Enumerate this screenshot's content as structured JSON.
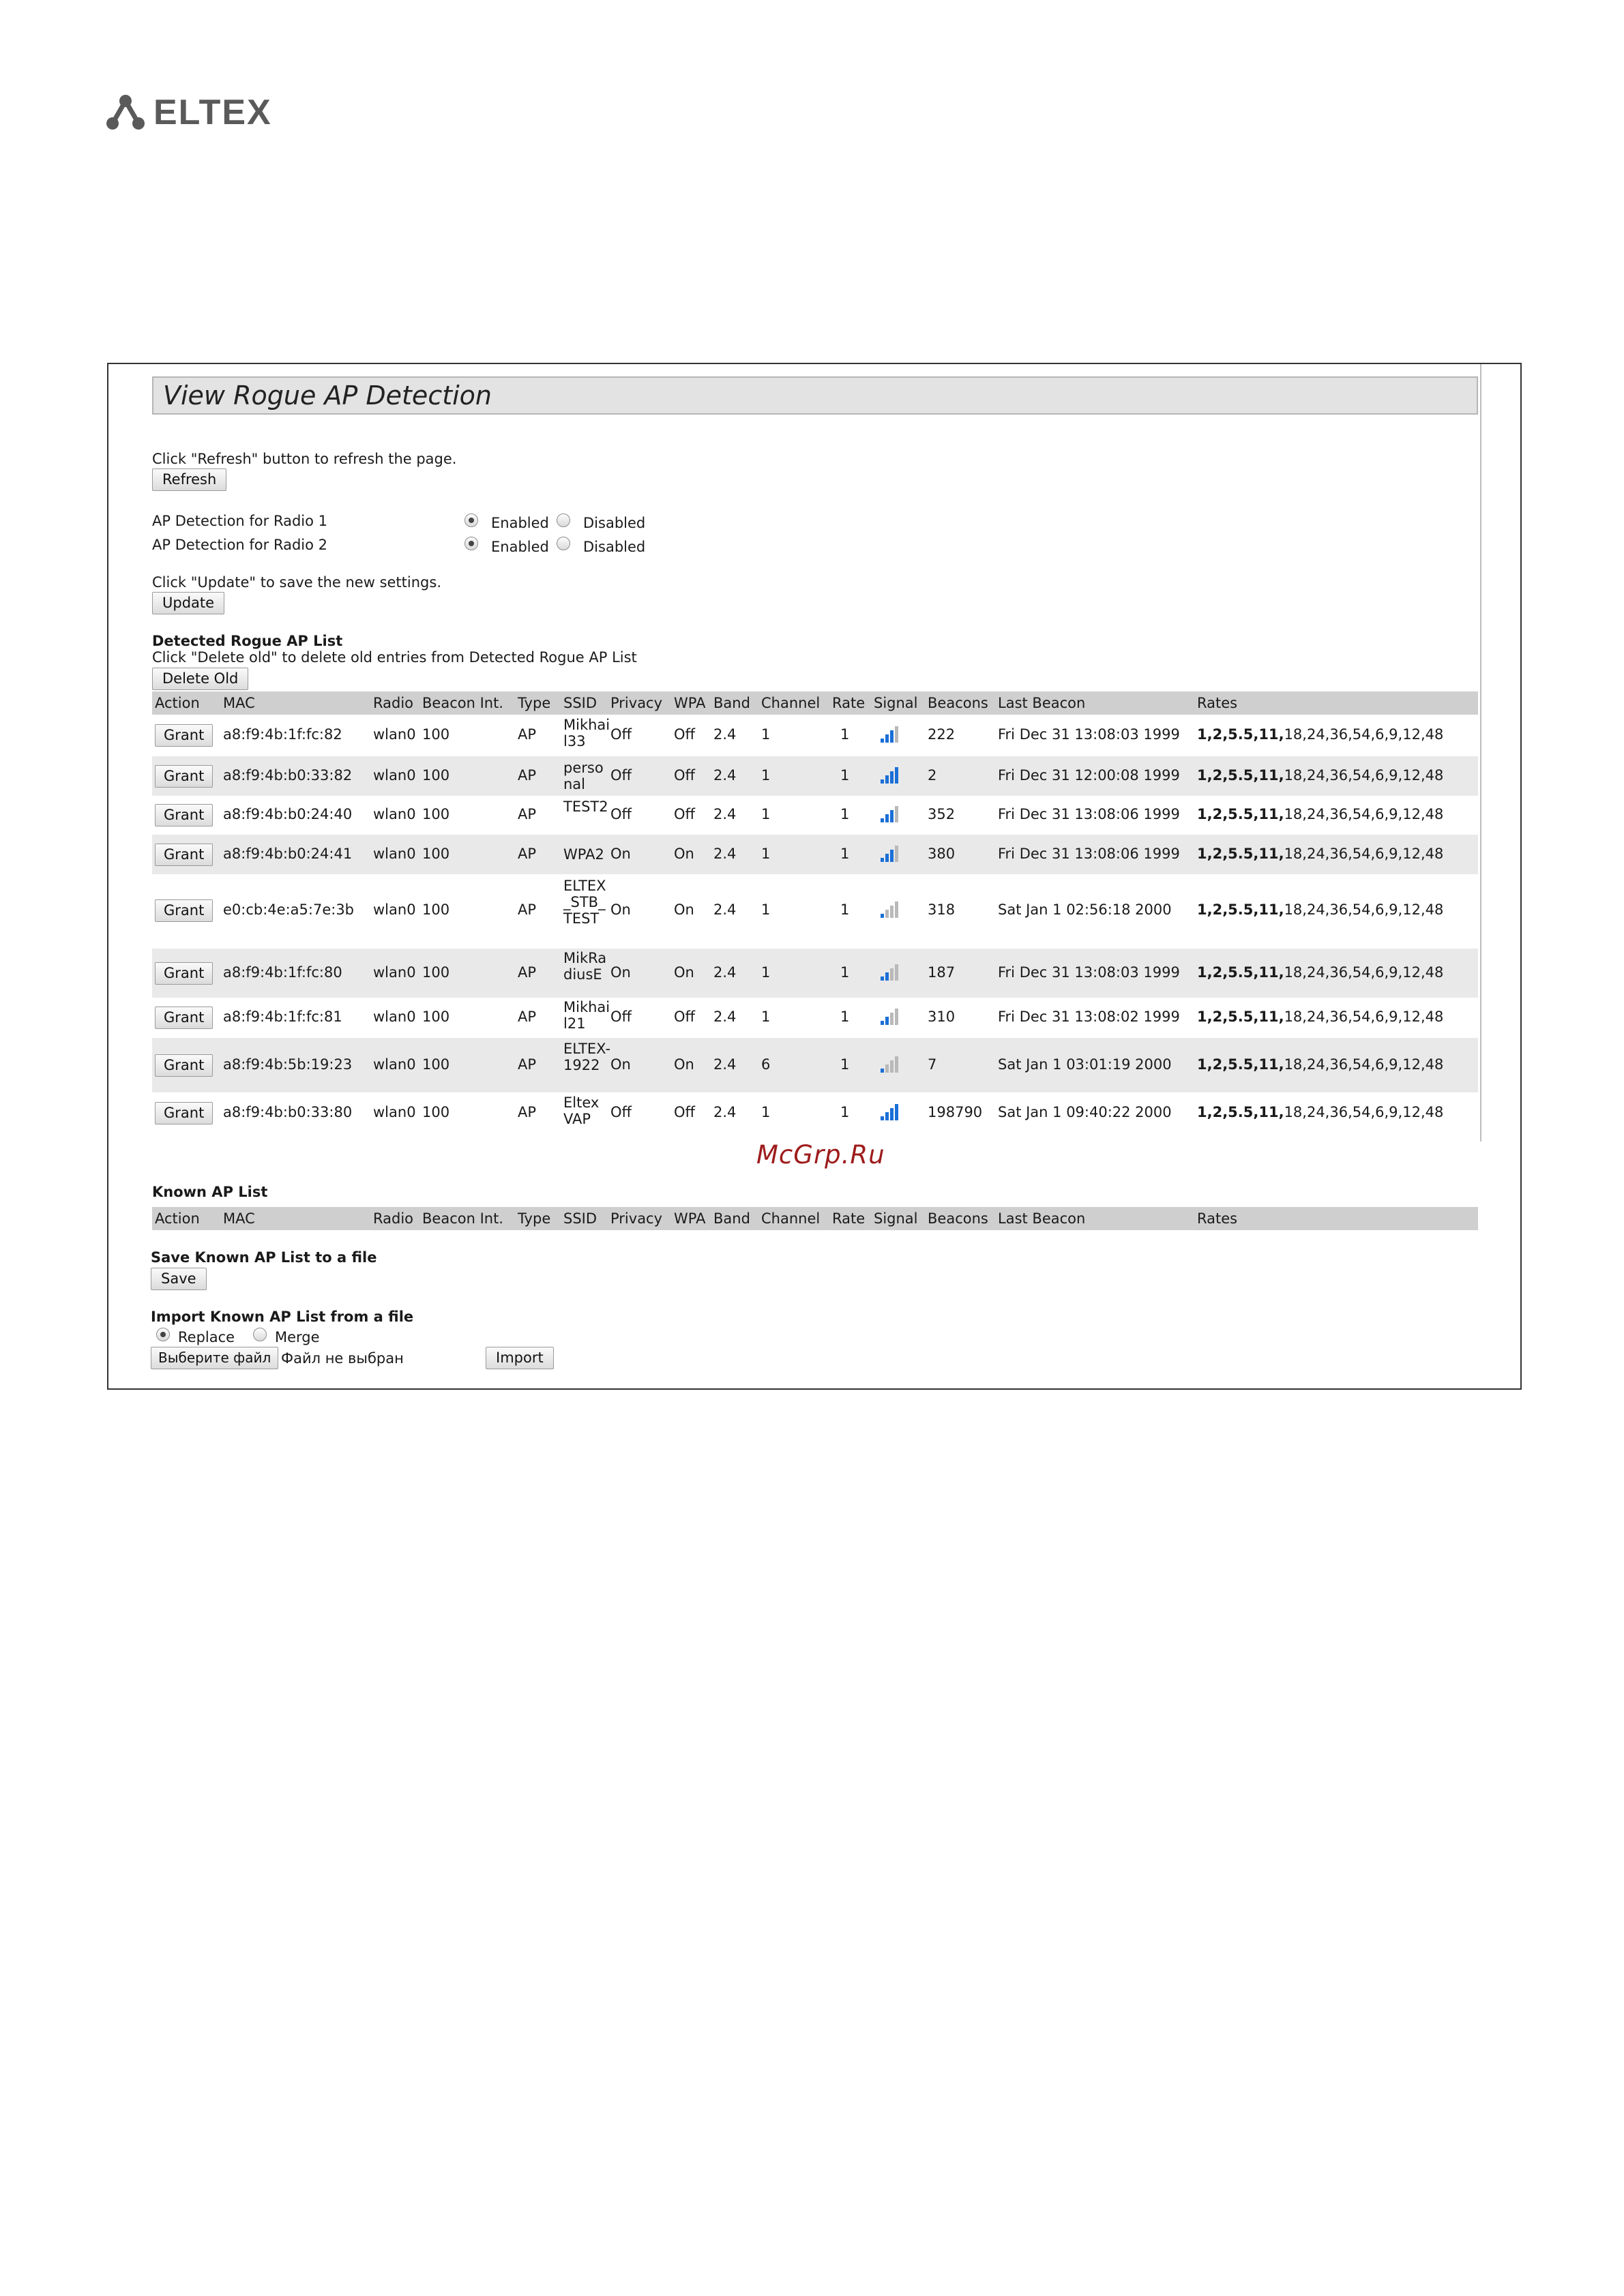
{
  "brand": {
    "name": "ELTEX"
  },
  "panel": {
    "title": "View Rogue AP Detection"
  },
  "refresh": {
    "hint": "Click \"Refresh\" button to refresh the page.",
    "button": "Refresh"
  },
  "detection": [
    {
      "label": "AP Detection for Radio 1",
      "enabled_label": "Enabled",
      "disabled_label": "Disabled",
      "selected": "Enabled"
    },
    {
      "label": "AP Detection for Radio 2",
      "enabled_label": "Enabled",
      "disabled_label": "Disabled",
      "selected": "Enabled"
    }
  ],
  "update": {
    "hint": "Click \"Update\" to save the new settings.",
    "button": "Update"
  },
  "detected": {
    "heading": "Detected Rogue AP List",
    "hint": "Click \"Delete old\" to delete old entries from Detected Rogue AP List",
    "delete_button": "Delete Old",
    "columns": [
      "Action",
      "MAC",
      "Radio",
      "Beacon Int.",
      "Type",
      "SSID",
      "Privacy",
      "WPA",
      "Band",
      "Channel",
      "Rate",
      "Signal",
      "Beacons",
      "Last Beacon",
      "Rates"
    ],
    "rates_bold": "1,2,5.5,11,",
    "rates_rest": "18,24,36,54,6,9,12,48",
    "rows": [
      {
        "action": "Grant",
        "mac": "a8:f9:4b:1f:fc:82",
        "radio": "wlan0",
        "beacon_int": "100",
        "type": "AP",
        "ssid": "Mikhail33",
        "privacy": "Off",
        "wpa": "Off",
        "band": "2.4",
        "channel": "1",
        "rate": "1",
        "signal": 3,
        "beacons": "222",
        "last_beacon": "Fri Dec 31 13:08:03 1999"
      },
      {
        "action": "Grant",
        "mac": "a8:f9:4b:b0:33:82",
        "radio": "wlan0",
        "beacon_int": "100",
        "type": "AP",
        "ssid": "personal",
        "privacy": "Off",
        "wpa": "Off",
        "band": "2.4",
        "channel": "1",
        "rate": "1",
        "signal": 4,
        "beacons": "2",
        "last_beacon": "Fri Dec 31 12:00:08 1999"
      },
      {
        "action": "Grant",
        "mac": "a8:f9:4b:b0:24:40",
        "radio": "wlan0",
        "beacon_int": "100",
        "type": "AP",
        "ssid": "TEST2",
        "privacy": "Off",
        "wpa": "Off",
        "band": "2.4",
        "channel": "1",
        "rate": "1",
        "signal": 3,
        "beacons": "352",
        "last_beacon": "Fri Dec 31 13:08:06 1999"
      },
      {
        "action": "Grant",
        "mac": "a8:f9:4b:b0:24:41",
        "radio": "wlan0",
        "beacon_int": "100",
        "type": "AP",
        "ssid": "WPA2",
        "privacy": "On",
        "wpa": "On",
        "band": "2.4",
        "channel": "1",
        "rate": "1",
        "signal": 3,
        "beacons": "380",
        "last_beacon": "Fri Dec 31 13:08:06 1999"
      },
      {
        "action": "Grant",
        "mac": "e0:cb:4e:a5:7e:3b",
        "radio": "wlan0",
        "beacon_int": "100",
        "type": "AP",
        "ssid": "ELTEX_STB_TEST",
        "privacy": "On",
        "wpa": "On",
        "band": "2.4",
        "channel": "1",
        "rate": "1",
        "signal": 1,
        "beacons": "318",
        "last_beacon": "Sat Jan 1 02:56:18 2000"
      },
      {
        "action": "Grant",
        "mac": "a8:f9:4b:1f:fc:80",
        "radio": "wlan0",
        "beacon_int": "100",
        "type": "AP",
        "ssid": "MikRadiusE",
        "privacy": "On",
        "wpa": "On",
        "band": "2.4",
        "channel": "1",
        "rate": "1",
        "signal": 2,
        "beacons": "187",
        "last_beacon": "Fri Dec 31 13:08:03 1999"
      },
      {
        "action": "Grant",
        "mac": "a8:f9:4b:1f:fc:81",
        "radio": "wlan0",
        "beacon_int": "100",
        "type": "AP",
        "ssid": "Mikhail21",
        "privacy": "Off",
        "wpa": "Off",
        "band": "2.4",
        "channel": "1",
        "rate": "1",
        "signal": 2,
        "beacons": "310",
        "last_beacon": "Fri Dec 31 13:08:02 1999"
      },
      {
        "action": "Grant",
        "mac": "a8:f9:4b:5b:19:23",
        "radio": "wlan0",
        "beacon_int": "100",
        "type": "AP",
        "ssid": "ELTEX-1922",
        "privacy": "On",
        "wpa": "On",
        "band": "2.4",
        "channel": "6",
        "rate": "1",
        "signal": 1,
        "beacons": "7",
        "last_beacon": "Sat Jan 1 03:01:19 2000"
      },
      {
        "action": "Grant",
        "mac": "a8:f9:4b:b0:33:80",
        "radio": "wlan0",
        "beacon_int": "100",
        "type": "AP",
        "ssid": "Eltex VAP",
        "privacy": "Off",
        "wpa": "Off",
        "band": "2.4",
        "channel": "1",
        "rate": "1",
        "signal": 4,
        "beacons": "198790",
        "last_beacon": "Sat Jan 1 09:40:22 2000"
      }
    ]
  },
  "watermark": "McGrp.Ru",
  "known": {
    "heading": "Known AP List",
    "columns": [
      "Action",
      "MAC",
      "Radio",
      "Beacon Int.",
      "Type",
      "SSID",
      "Privacy",
      "WPA",
      "Band",
      "Channel",
      "Rate",
      "Signal",
      "Beacons",
      "Last Beacon",
      "Rates"
    ]
  },
  "save": {
    "heading": "Save Known AP List to a file",
    "button": "Save"
  },
  "import": {
    "heading": "Import Known AP List from a file",
    "replace_label": "Replace",
    "merge_label": "Merge",
    "selected": "Replace",
    "choose_button": "Выберите файл",
    "no_file": "Файл не выбран",
    "import_button": "Import"
  },
  "colors": {
    "signal_on": "#1a6fd6",
    "signal_off": "#b9b9b9",
    "header_bg": "#cfcfcf",
    "row_alt": "#e9e9e9",
    "watermark": "#9e1b1b"
  }
}
